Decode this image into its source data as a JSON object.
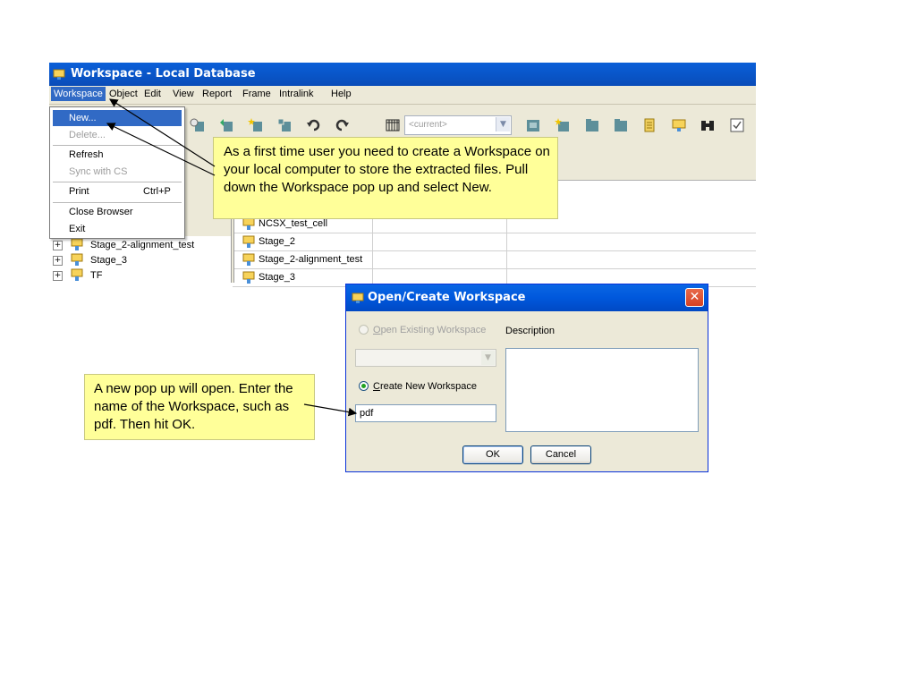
{
  "window": {
    "title": "Workspace - Local Database",
    "menus": [
      "Workspace",
      "Object",
      "Edit",
      "View",
      "Report",
      "Frame",
      "Intralink",
      "Help"
    ],
    "combo_value": "<current>"
  },
  "dropdown": {
    "items": [
      {
        "label": "New...",
        "shortcut": ""
      },
      {
        "label": "Delete...",
        "shortcut": ""
      },
      {
        "label": "Refresh",
        "shortcut": ""
      },
      {
        "label": "Sync with CS",
        "shortcut": ""
      },
      {
        "label": "Print",
        "shortcut": "Ctrl+P"
      },
      {
        "label": "Close Browser",
        "shortcut": ""
      },
      {
        "label": "Exit",
        "shortcut": ""
      }
    ]
  },
  "grid": {
    "rows": [
      "NCSX_test_cell",
      "Stage_2",
      "Stage_2-alignment_test",
      "Stage_3"
    ]
  },
  "tree": {
    "nodes": [
      "Stage_2-alignment_test",
      "Stage_3",
      "TF"
    ]
  },
  "callouts": {
    "first": "As a first time user you need to create a Workspace on your local computer to store the extracted files.   Pull down the Workspace pop up and select New.",
    "second": "A new pop up will open.  Enter the name of the Workspace, such as pdf.  Then hit OK."
  },
  "dialog": {
    "title": "Open/Create Workspace",
    "close": "✕",
    "open_existing_prefix": "O",
    "open_existing_rest": "pen Existing Workspace",
    "description_label": "Description",
    "create_new_prefix": "C",
    "create_new_rest": "reate New Workspace",
    "name_value": "pdf",
    "ok_label": "OK",
    "cancel_label": "Cancel"
  },
  "colors": {
    "callout": "#ffff99",
    "titlebar": "#0a5fd8",
    "selection": "#316ac5"
  }
}
